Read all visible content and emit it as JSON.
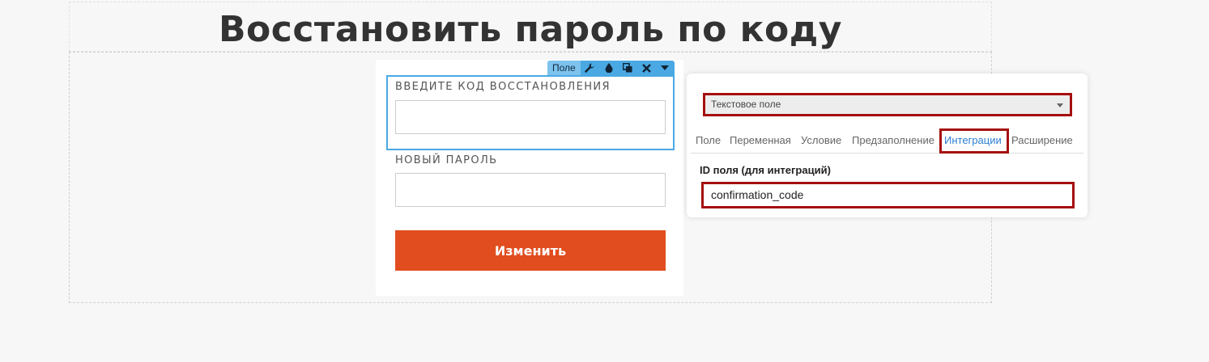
{
  "page": {
    "title": "Восстановить пароль по коду"
  },
  "form": {
    "fields": [
      {
        "label": "ВВЕДИТЕ КОД ВОССТАНОВЛЕНИЯ",
        "value": ""
      },
      {
        "label": "НОВЫЙ ПАРОЛЬ",
        "value": ""
      }
    ],
    "submit_label": "Изменить",
    "submit_color": "#e14d1e"
  },
  "field_toolbar": {
    "label": "Поле",
    "icons": [
      "wrench-icon",
      "droplet-icon",
      "duplicate-icon",
      "close-icon",
      "caret-down-icon"
    ],
    "color": "#4aa9e3"
  },
  "settings_panel": {
    "field_type": "Текстовое поле",
    "tabs": [
      "Поле",
      "Переменная",
      "Условие",
      "Предзаполнение",
      "Интеграции",
      "Расширение"
    ],
    "active_tab": "Интеграции",
    "id_label": "ID поля (для интеграций)",
    "id_value": "confirmation_code",
    "highlight_color": "#a50f0f"
  }
}
